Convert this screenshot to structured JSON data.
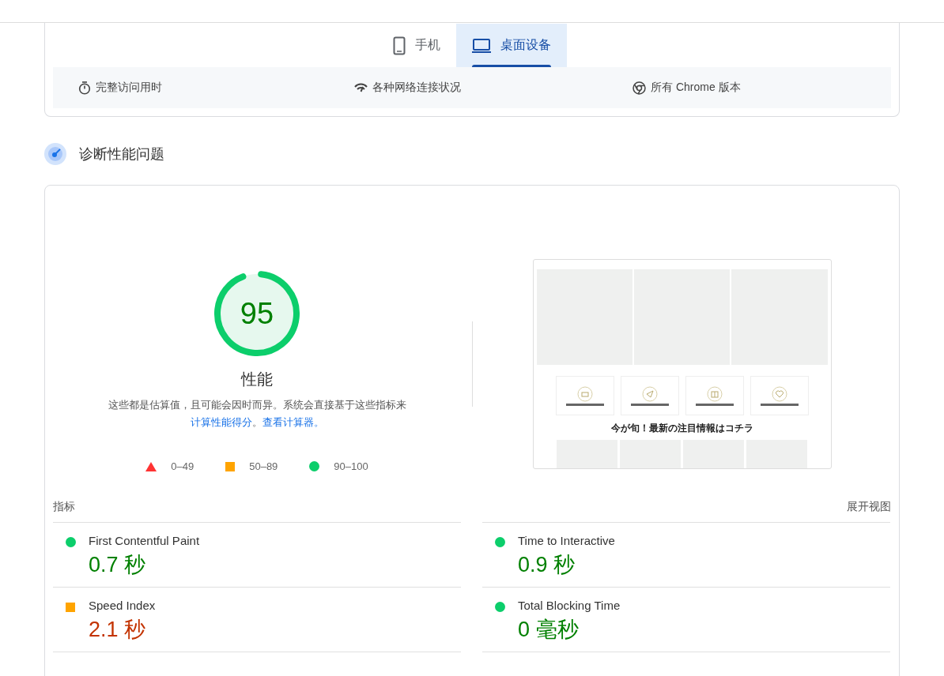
{
  "tabs": [
    {
      "label": "手机",
      "kind": "phone",
      "selected": false
    },
    {
      "label": "桌面设备",
      "kind": "desktop",
      "selected": true
    }
  ],
  "collection_info": [
    {
      "kind": "timer",
      "text": "完整访问用时"
    },
    {
      "kind": "network",
      "text": "各种网络连接状况"
    },
    {
      "kind": "chrome",
      "text": "所有 Chrome 版本"
    }
  ],
  "section_title": "诊断性能问题",
  "gauge": {
    "score": "95",
    "level": 0.95,
    "kind": "pass",
    "label": "性能"
  },
  "description": [
    {
      "text": "这些都是估算值，且可能会因时而异。系统会直接基于这些指标来",
      "kind": "text"
    },
    {
      "text": "计算性能得分",
      "kind": "link"
    },
    {
      "text": "。",
      "kind": "text"
    },
    {
      "text": "查看计算器。",
      "kind": "link"
    }
  ],
  "legend": [
    {
      "kind": "fail",
      "text": "0–49"
    },
    {
      "kind": "average",
      "text": "50–89"
    },
    {
      "kind": "pass",
      "text": "90–100"
    }
  ],
  "screenshot": {
    "headline": "今が旬！最新の注目情報はコチラ"
  },
  "metrics_header": {
    "title": "指标",
    "toggle": "展开视图"
  },
  "metrics": [
    {
      "name": "First Contentful Paint",
      "value": "0.7 秒",
      "kind": "pass"
    },
    {
      "name": "Time to Interactive",
      "value": "0.9 秒",
      "kind": "pass"
    },
    {
      "name": "Speed Index",
      "value": "2.1 秒",
      "kind": "average"
    },
    {
      "name": "Total Blocking Time",
      "value": "0 毫秒",
      "kind": "pass"
    }
  ]
}
